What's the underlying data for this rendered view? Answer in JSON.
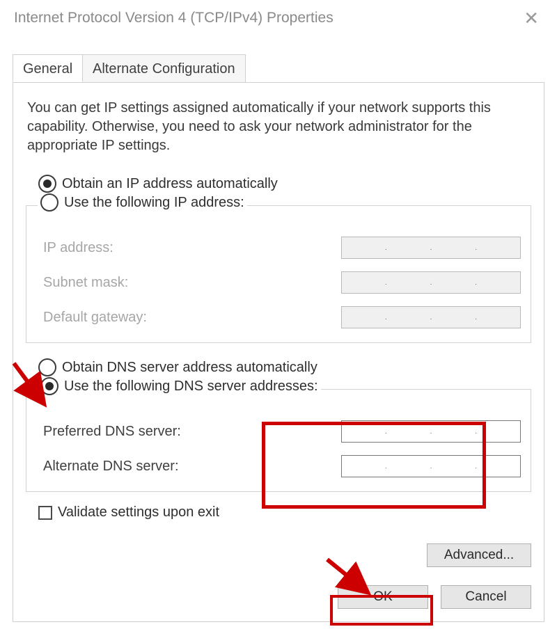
{
  "window": {
    "title": "Internet Protocol Version 4 (TCP/IPv4) Properties"
  },
  "tabs": {
    "general": "General",
    "alternate": "Alternate Configuration"
  },
  "intro": "You can get IP settings assigned automatically if your network supports this capability. Otherwise, you need to ask your network administrator for the appropriate IP settings.",
  "ip": {
    "auto_label": "Obtain an IP address automatically",
    "auto_checked": true,
    "manual_label": "Use the following IP address:",
    "manual_checked": false,
    "fields": {
      "ip_address": {
        "label": "IP address:",
        "value": ""
      },
      "subnet_mask": {
        "label": "Subnet mask:",
        "value": ""
      },
      "default_gateway": {
        "label": "Default gateway:",
        "value": ""
      }
    }
  },
  "dns": {
    "auto_label": "Obtain DNS server address automatically",
    "auto_checked": false,
    "manual_label": "Use the following DNS server addresses:",
    "manual_checked": true,
    "fields": {
      "preferred": {
        "label": "Preferred DNS server:",
        "value": ""
      },
      "alternate": {
        "label": "Alternate DNS server:",
        "value": ""
      }
    }
  },
  "validate": {
    "label": "Validate settings upon exit",
    "checked": false
  },
  "buttons": {
    "advanced": "Advanced...",
    "ok": "OK",
    "cancel": "Cancel"
  },
  "annotations": {
    "highlight_color": "#cc0000"
  }
}
